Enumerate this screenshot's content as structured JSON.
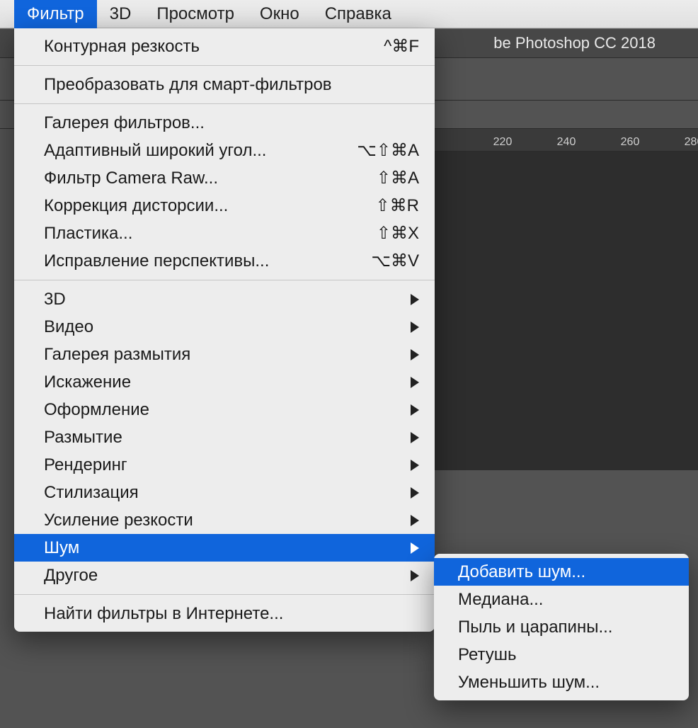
{
  "menubar": {
    "items": [
      "Фильтр",
      "3D",
      "Просмотр",
      "Окно",
      "Справка"
    ],
    "active_index": 0
  },
  "titlebar": {
    "text_visible": "be Photoshop CC 2018"
  },
  "ruler": {
    "labels": [
      "220",
      "240",
      "260",
      "280"
    ]
  },
  "filter_menu": {
    "groups": [
      [
        {
          "label": "Контурная резкость",
          "shortcut": "^⌘F"
        }
      ],
      [
        {
          "label": "Преобразовать для смарт-фильтров"
        }
      ],
      [
        {
          "label": "Галерея фильтров..."
        },
        {
          "label": "Адаптивный широкий угол...",
          "shortcut": "⌥⇧⌘A"
        },
        {
          "label": "Фильтр Camera Raw...",
          "shortcut": "⇧⌘A"
        },
        {
          "label": "Коррекция дисторсии...",
          "shortcut": "⇧⌘R"
        },
        {
          "label": "Пластика...",
          "shortcut": "⇧⌘X"
        },
        {
          "label": "Исправление перспективы...",
          "shortcut": "⌥⌘V"
        }
      ],
      [
        {
          "label": "3D",
          "submenu": true
        },
        {
          "label": "Видео",
          "submenu": true
        },
        {
          "label": "Галерея размытия",
          "submenu": true
        },
        {
          "label": "Искажение",
          "submenu": true
        },
        {
          "label": "Оформление",
          "submenu": true
        },
        {
          "label": "Размытие",
          "submenu": true
        },
        {
          "label": "Рендеринг",
          "submenu": true
        },
        {
          "label": "Стилизация",
          "submenu": true
        },
        {
          "label": "Усиление резкости",
          "submenu": true
        },
        {
          "label": "Шум",
          "submenu": true,
          "highlight": true
        },
        {
          "label": "Другое",
          "submenu": true
        }
      ],
      [
        {
          "label": "Найти фильтры в Интернете..."
        }
      ]
    ]
  },
  "noise_submenu": {
    "items": [
      {
        "label": "Добавить шум...",
        "highlight": true
      },
      {
        "label": "Медиана..."
      },
      {
        "label": "Пыль и царапины..."
      },
      {
        "label": "Ретушь"
      },
      {
        "label": "Уменьшить шум..."
      }
    ]
  }
}
